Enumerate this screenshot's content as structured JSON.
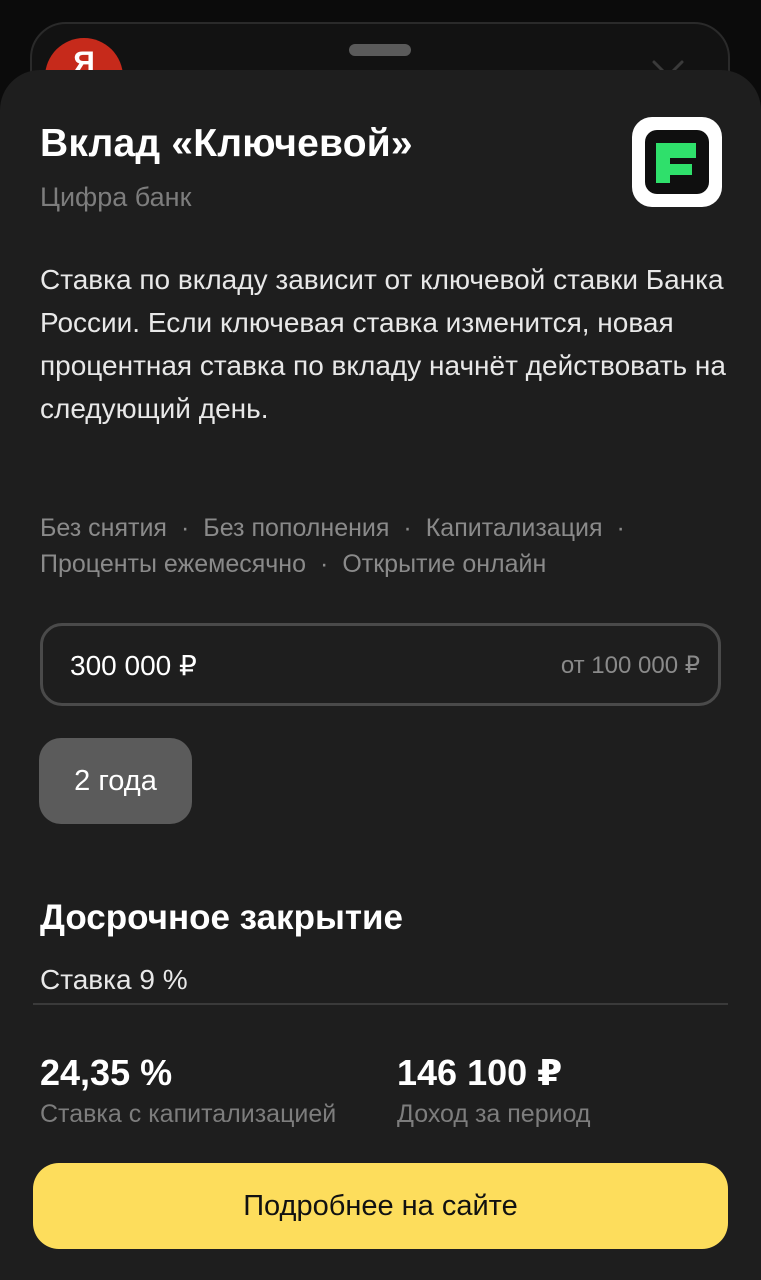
{
  "background": {
    "app_logo_letter": "Я"
  },
  "deposit": {
    "title": "Вклад «Ключевой»",
    "bank": "Цифра банк",
    "description": "Ставка по вкладу зависит от ключевой ставки Банка России. Если ключевая ставка изменится, новая процентная ставка по вкладу начнёт действовать на следующий день.",
    "features": [
      "Без снятия",
      "Без пополнения",
      "Капитализация",
      "Проценты ежемесячно",
      "Открытие онлайн"
    ]
  },
  "amount": {
    "value": "300 000 ₽",
    "hint": "от 100 000 ₽"
  },
  "term": {
    "selected": "2 года"
  },
  "early_closing": {
    "title": "Досрочное закрытие",
    "rate": "Ставка 9 %"
  },
  "stats": {
    "rate_value": "24,35 %",
    "rate_label": "Ставка с капитализацией",
    "income_value": "146 100 ₽",
    "income_label": "Доход за период"
  },
  "cta_label": "Подробнее на сайте",
  "colors": {
    "sheet": "#1e1e1e",
    "cta": "#fddd5c",
    "bank_logo_green": "#2fe06b",
    "app_logo_red": "#c62a1b"
  }
}
